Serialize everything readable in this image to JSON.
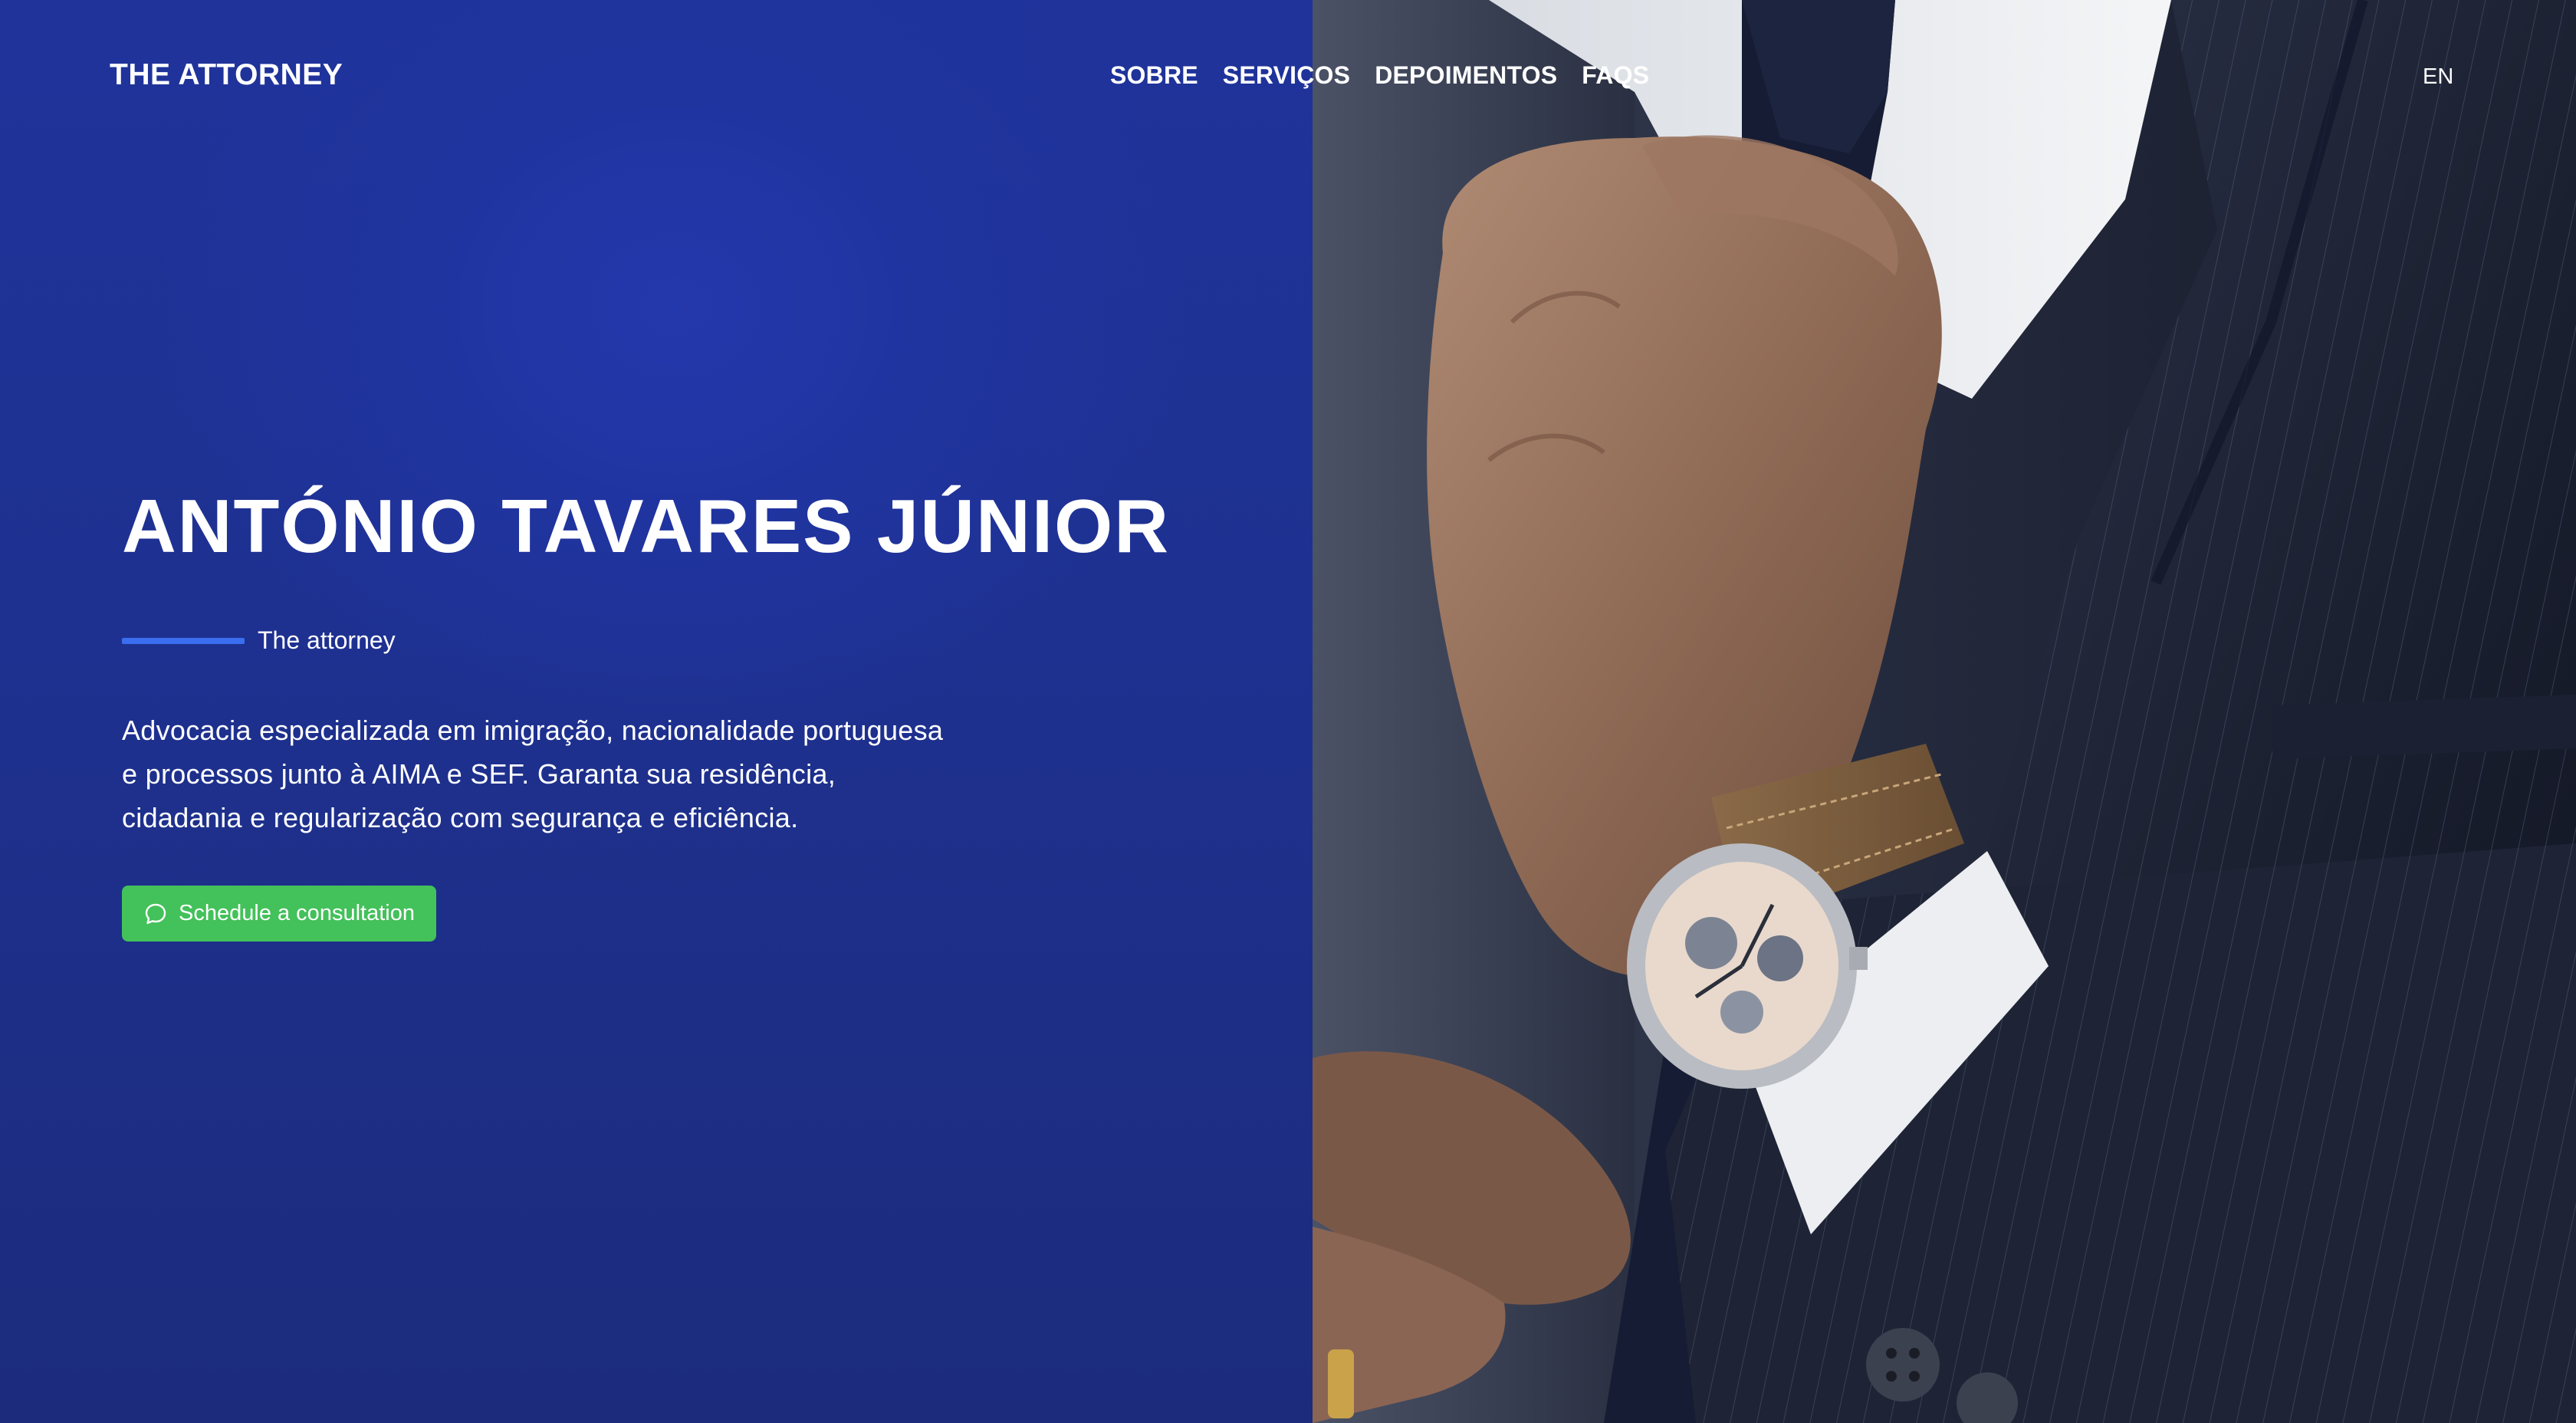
{
  "header": {
    "logo": "THE ATTORNEY",
    "nav": [
      "SOBRE",
      "SERVIÇOS",
      "DEPOIMENTOS",
      "FAQS"
    ],
    "language": "EN"
  },
  "hero": {
    "title": "ANTÓNIO TAVARES JÚNIOR",
    "tagline": "The attorney",
    "description_lines": [
      "Advocacia especializada em imigração, nacionalidade portuguesa",
      "e processos junto à AIMA e SEF. Garanta sua residência,",
      "cidadania e regularização com segurança e eficiência."
    ],
    "cta_label": "Schedule a consultation",
    "cta_icon": "chat-bubble-icon"
  },
  "colors": {
    "panel_blue": "#2034a0",
    "accent_line": "#3b6df0",
    "cta_green": "#43c15a",
    "text": "#ffffff"
  }
}
